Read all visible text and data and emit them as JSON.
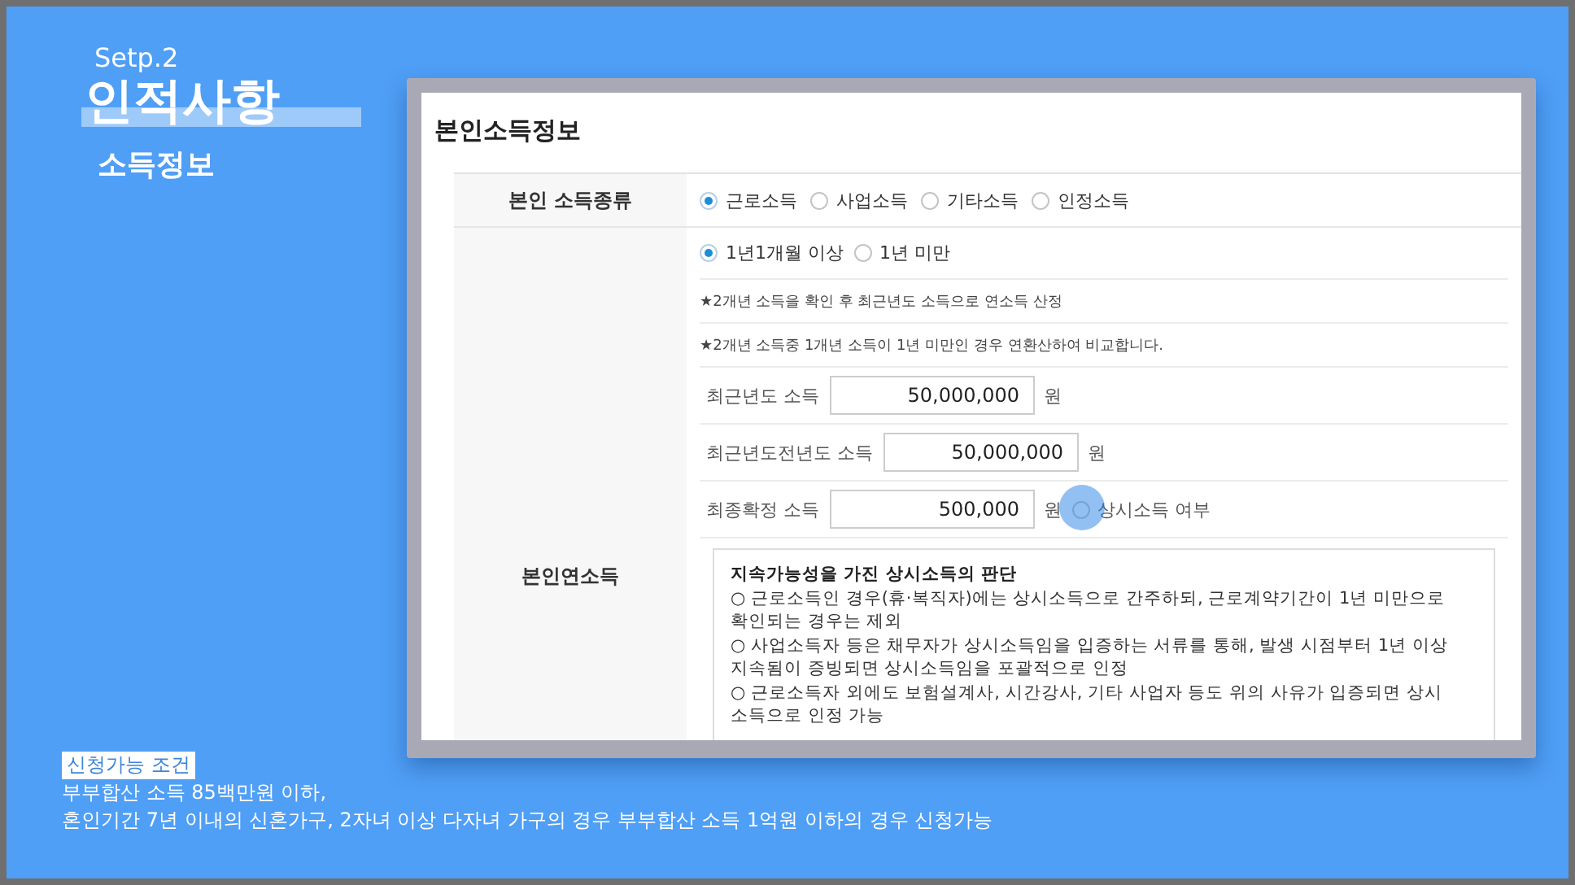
{
  "header": {
    "step": "Setp.2",
    "title": "인적사항",
    "subtitle": "소득정보"
  },
  "panel": {
    "title": "본인소득정보",
    "income_type": {
      "label": "본인 소득종류",
      "options": [
        {
          "label": "근로소득",
          "selected": true
        },
        {
          "label": "사업소득",
          "selected": false
        },
        {
          "label": "기타소득",
          "selected": false
        },
        {
          "label": "인정소득",
          "selected": false
        }
      ]
    },
    "annual_income": {
      "label": "본인연소득",
      "period_options": [
        {
          "label": "1년1개월 이상",
          "selected": true
        },
        {
          "label": "1년 미만",
          "selected": false
        }
      ],
      "notes": [
        "2개년 소득을 확인 후 최근년도 소득으로 연소득 산정",
        "2개년 소득중 1개년 소득이 1년 미만인 경우 연환산하여 비교합니다."
      ],
      "note_mark": "★",
      "fields": [
        {
          "label": "최근년도 소득",
          "value": "50,000,000",
          "unit": "원"
        },
        {
          "label": "최근년도전년도 소득",
          "value": "50,000,000",
          "unit": "원"
        },
        {
          "label": "최종확정 소득",
          "value": "500,000",
          "unit": "원"
        }
      ],
      "regular_income": {
        "label": "상시소득 여부",
        "checked": false,
        "pointer_highlight": true
      },
      "info_box": {
        "title": "지속가능성을 가진 상시소득의 판단",
        "lines": [
          "○ 근로소득인 경우(휴·복직자)에는 상시소득으로 간주하되, 근로계약기간이 1년 미만으로 확인되는 경우는 제외",
          "○ 사업소득자 등은 채무자가 상시소득임을 입증하는 서류를 통해, 발생 시점부터 1년 이상 지속됨이 증빙되면 상시소득임을 포괄적으로 인정",
          "○ 근로소득자 외에도 보험설계사, 시간강사, 기타 사업자 등도 위의 사유가 입증되면 상시소득으로 인정 가능"
        ]
      }
    }
  },
  "conditions": {
    "tag": "신청가능 조건",
    "lines": [
      "부부합산 소득 85백만원 이하,",
      "혼인기간 7년 이내의 신혼가구, 2자녀 이상 다자녀 가구의 경우 부부합산 소득 1억원 이하의 경우 신청가능"
    ]
  }
}
